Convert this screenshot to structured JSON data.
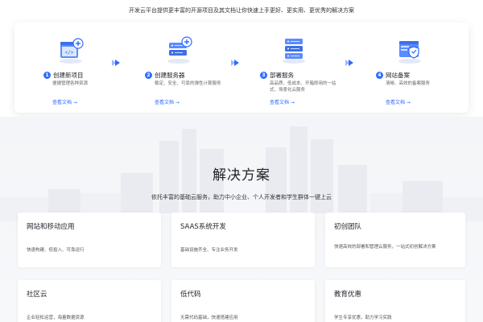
{
  "intro": "开发云平台提供更丰富的开源项目及其文档让你快速上手更好、更实用、更优秀的解决方案",
  "steps": [
    {
      "num": "1",
      "title": "创建新项目",
      "desc": "便捷管理各种资源",
      "link": "查看文档 →",
      "icon": "code-window-plus-icon"
    },
    {
      "num": "2",
      "title": "创建服务器",
      "desc": "稳定、安全、可靠的弹性计算服务",
      "link": "查看文档 →",
      "icon": "server-plus-icon"
    },
    {
      "num": "3",
      "title": "部署服务",
      "desc": "高品质、低成本、开箱即用的一站式、场景化云服务",
      "link": "查看文档 →",
      "icon": "server-stack-icon"
    },
    {
      "num": "4",
      "title": "网站备案",
      "desc": "清晰、高效的备案服务",
      "link": "查看文档 →",
      "icon": "shield-window-icon"
    }
  ],
  "solutions": {
    "title": "解决方案",
    "subtitle": "依托丰富的基础云服务，助力中小企业、个人开发者和学生群体一键上云",
    "cards": [
      {
        "title": "网站和移动应用",
        "desc": "快速构建、低投入、可靠运行"
      },
      {
        "title": "SAAS系统开发",
        "desc": "基础设施齐全、专注业务开发"
      },
      {
        "title": "初创团队",
        "desc": "快速高效的部署和管理云服务，一站式初创解决方案"
      },
      {
        "title": "社区云",
        "desc": "企业轻松运营，海量数据资源"
      },
      {
        "title": "低代码",
        "desc": "无需代码基础，快速搭建应用"
      },
      {
        "title": "教育优惠",
        "desc": "学生专享优惠，助力学习实践"
      }
    ]
  },
  "colors": {
    "accent": "#2f6bff",
    "bg_section": "#f4f5f8"
  }
}
